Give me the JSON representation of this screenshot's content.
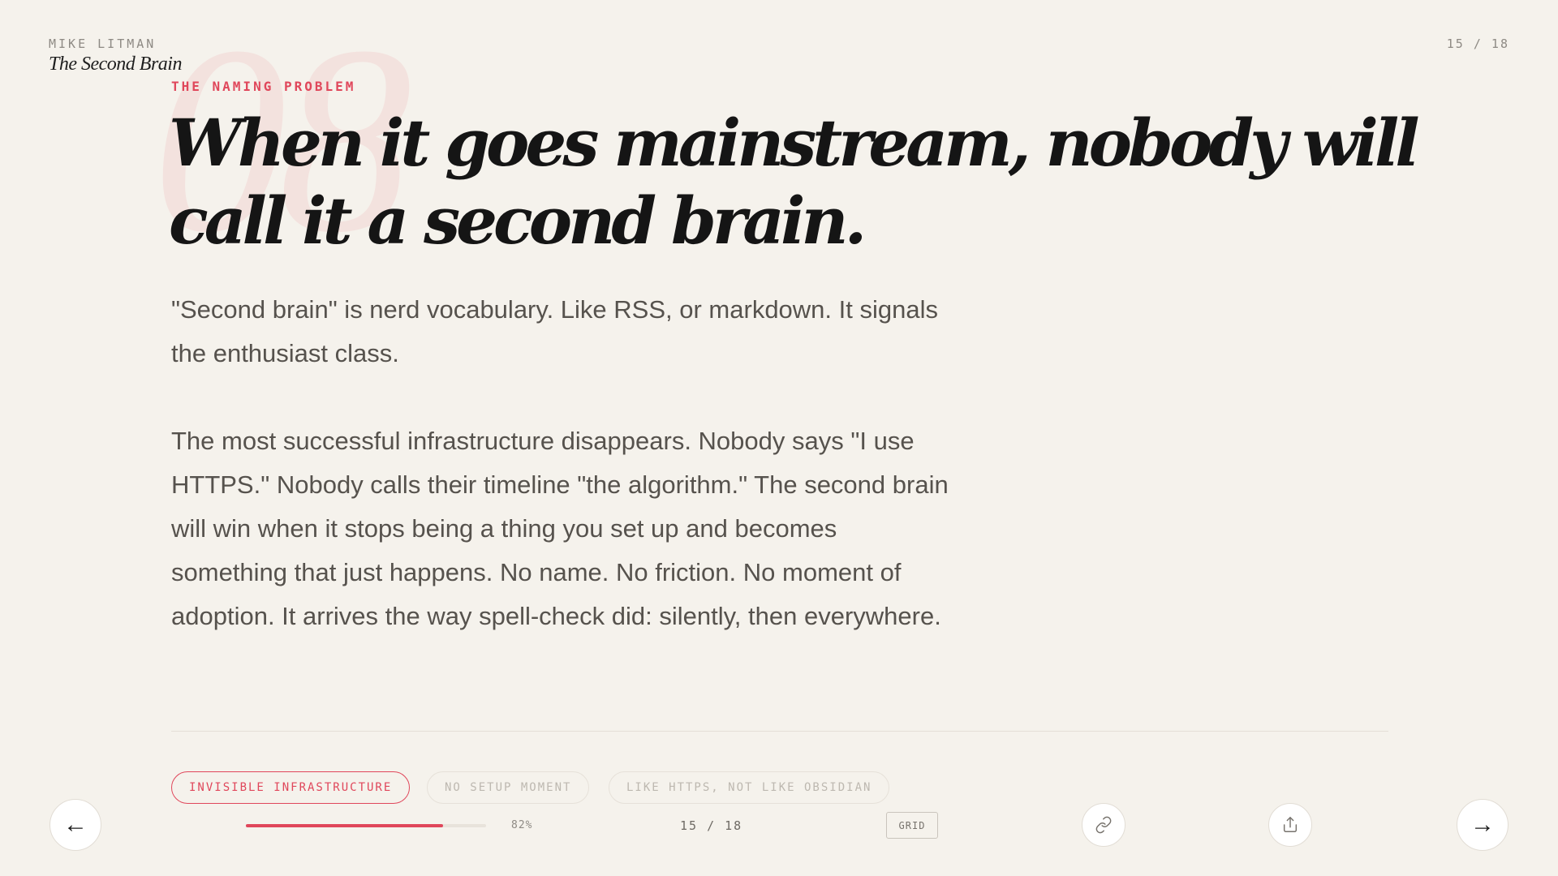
{
  "header": {
    "author": "MIKE LITMAN",
    "deck_title": "The Second Brain",
    "page_counter": "15 / 18"
  },
  "slide": {
    "ghost_number": "08",
    "kicker": "THE NAMING PROBLEM",
    "headline": "When it goes mainstream, nobody will call it a second brain.",
    "paragraphs": [
      "\"Second brain\" is nerd vocabulary. Like RSS, or markdown. It signals the enthusiast class.",
      "The most successful infrastructure disappears. Nobody says \"I use HTTPS.\" Nobody calls their timeline \"the algorithm.\" The second brain will win when it stops being a thing you set up and becomes something that just happens. No name. No friction. No moment of adoption. It arrives the way spell-check did: silently, then everywhere."
    ],
    "tags": [
      {
        "label": "INVISIBLE INFRASTRUCTURE",
        "active": true
      },
      {
        "label": "NO SETUP MOMENT",
        "active": false
      },
      {
        "label": "LIKE HTTPS, NOT LIKE OBSIDIAN",
        "active": false
      }
    ]
  },
  "footer": {
    "prev_icon": "arrow-left-icon",
    "next_icon": "arrow-right-icon",
    "prev_glyph": "←",
    "next_glyph": "→",
    "progress_percent": 82,
    "progress_label": "82%",
    "page_counter": "15 / 18",
    "grid_label": "GRID",
    "link_icon": "link-icon",
    "share_icon": "share-icon"
  },
  "colors": {
    "accent": "#e0475b",
    "background": "#f5f2ec",
    "text": "#151515",
    "muted": "#8e8a84"
  }
}
